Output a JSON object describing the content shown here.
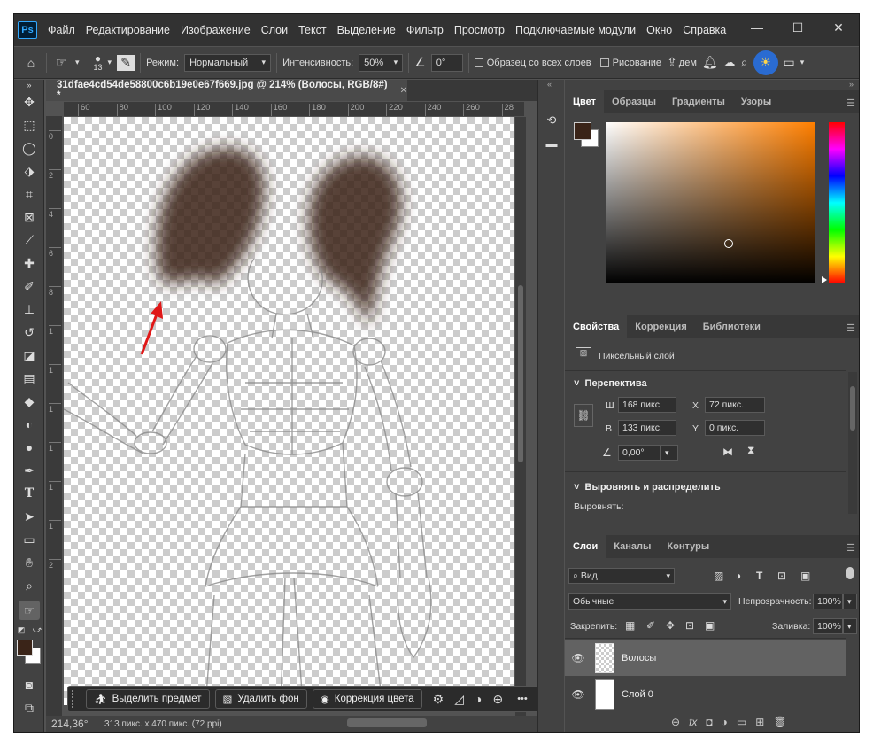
{
  "app": {
    "logo": "Ps"
  },
  "menu": [
    "Файл",
    "Редактирование",
    "Изображение",
    "Слои",
    "Текст",
    "Выделение",
    "Фильтр",
    "Просмотр",
    "Подключаемые модули",
    "Окно",
    "Справка"
  ],
  "window_controls": {
    "minimize": "—",
    "maximize": "☐",
    "close": "✕"
  },
  "options": {
    "brush_size": "13",
    "mode_label": "Режим:",
    "mode_value": "Нормальный",
    "intensity_label": "Интенсивность:",
    "intensity_value": "50%",
    "angle_value": "0°",
    "sample_all_label": "Образец со всех слоев",
    "drawing_label": "Рисование",
    "extra": "дем"
  },
  "document": {
    "tab_title": "31dfae4cd54de58800c6b19e0e67f669.jpg @ 214% (Волосы, RGB/8#) *",
    "close": "✕"
  },
  "ruler_h": [
    "60",
    "80",
    "100",
    "120",
    "140",
    "160",
    "180",
    "200",
    "220",
    "240",
    "260",
    "28"
  ],
  "ruler_v": [
    "0",
    "2",
    "4",
    "6",
    "8",
    "1",
    "1",
    "1",
    "1",
    "1",
    "1",
    "2"
  ],
  "context_bar": {
    "select_subject": "Выделить предмет",
    "remove_bg": "Удалить фон",
    "color_correction": "Коррекция цвета",
    "more": "•••"
  },
  "status": {
    "zoom": "214,36°",
    "size": "313 пикс. x 470 пикс. (72 ppi)"
  },
  "color_panel": {
    "tabs": [
      "Цвет",
      "Образцы",
      "Градиенты",
      "Узоры"
    ],
    "foreground": "#3a2418",
    "background": "#ffffff",
    "accent_hue": "#ff7f00"
  },
  "properties_panel": {
    "tabs": [
      "Свойства",
      "Коррекция",
      "Библиотеки"
    ],
    "layer_type": "Пиксельный слой",
    "section_perspective": "Перспектива",
    "w_label": "Ш",
    "w_value": "168 пикс.",
    "x_label": "X",
    "x_value": "72 пикс.",
    "h_label": "В",
    "h_value": "133 пикс.",
    "y_label": "Y",
    "y_value": "0 пикс.",
    "angle_value": "0,00°",
    "section_align": "Выровнять и распределить",
    "align_label": "Выровнять:"
  },
  "layers_panel": {
    "tabs": [
      "Слои",
      "Каналы",
      "Контуры"
    ],
    "filter_kind": "Вид",
    "blend_mode": "Обычные",
    "opacity_label": "Непрозрачность:",
    "opacity_value": "100%",
    "lock_label": "Закрепить:",
    "fill_label": "Заливка:",
    "fill_value": "100%",
    "layers": [
      {
        "name": "Волосы"
      },
      {
        "name": "Слой 0"
      }
    ]
  }
}
